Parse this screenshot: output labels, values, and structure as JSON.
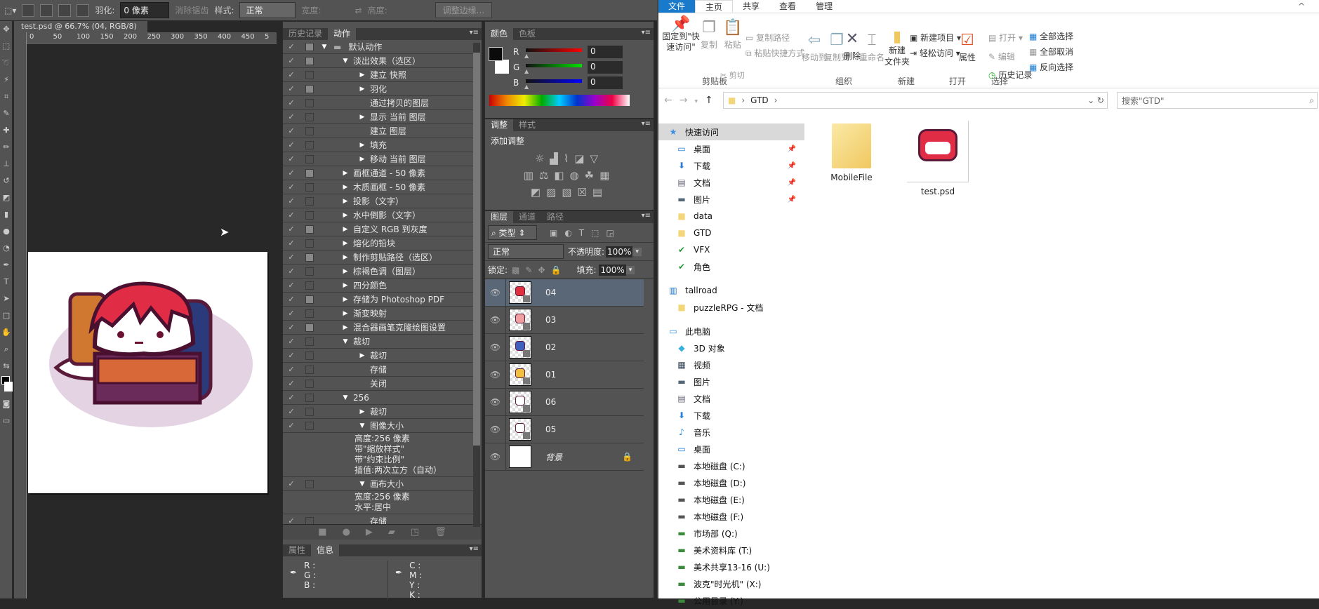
{
  "options_bar": {
    "feather_label": "羽化:",
    "feather_value": "0 像素",
    "antialias": "消除锯齿",
    "style_label": "样式:",
    "style_value": "正常",
    "width_label": "宽度:",
    "height_label": "高度:",
    "refine_edge": "调整边缘..."
  },
  "document": {
    "tab": "test.psd @ 66.7% (04, RGB/8)",
    "close": "×",
    "ruler_h": [
      "0",
      "50",
      "100",
      "150",
      "200",
      "250",
      "300",
      "350",
      "400",
      "450",
      "5"
    ]
  },
  "actions_panel": {
    "tabs": [
      "历史记录",
      "动作"
    ],
    "rows": [
      {
        "label": "默认动作",
        "level": 0,
        "tri": "▼",
        "dialog": true,
        "folder": true
      },
      {
        "label": "淡出效果（选区）",
        "level": 1,
        "tri": "▼",
        "dialog": true
      },
      {
        "label": "建立 快照",
        "level": 2,
        "tri": "▶",
        "dialog": false
      },
      {
        "label": "羽化",
        "level": 2,
        "tri": "▶",
        "dialog": true
      },
      {
        "label": "通过拷贝的图层",
        "level": 2,
        "tri": "",
        "dialog": false
      },
      {
        "label": "显示 当前 图层",
        "level": 2,
        "tri": "▶",
        "dialog": false
      },
      {
        "label": "建立 图层",
        "level": 2,
        "tri": "",
        "dialog": false
      },
      {
        "label": "填充",
        "level": 2,
        "tri": "▶",
        "dialog": false
      },
      {
        "label": "移动 当前 图层",
        "level": 2,
        "tri": "▶",
        "dialog": false
      },
      {
        "label": "画框通道 - 50 像素",
        "level": 1,
        "tri": "▶",
        "dialog": true
      },
      {
        "label": "木质画框 - 50 像素",
        "level": 1,
        "tri": "▶",
        "dialog": false
      },
      {
        "label": "投影（文字）",
        "level": 1,
        "tri": "▶",
        "dialog": false
      },
      {
        "label": "水中倒影（文字）",
        "level": 1,
        "tri": "▶",
        "dialog": false
      },
      {
        "label": "自定义 RGB 到灰度",
        "level": 1,
        "tri": "▶",
        "dialog": true
      },
      {
        "label": "熔化的铅块",
        "level": 1,
        "tri": "▶",
        "dialog": false
      },
      {
        "label": "制作剪贴路径（选区）",
        "level": 1,
        "tri": "▶",
        "dialog": true
      },
      {
        "label": "棕褐色调（图层）",
        "level": 1,
        "tri": "▶",
        "dialog": false
      },
      {
        "label": "四分颜色",
        "level": 1,
        "tri": "▶",
        "dialog": false
      },
      {
        "label": "存储为 Photoshop PDF",
        "level": 1,
        "tri": "▶",
        "dialog": true
      },
      {
        "label": "渐变映射",
        "level": 1,
        "tri": "▶",
        "dialog": false
      },
      {
        "label": "混合器画笔克隆绘图设置",
        "level": 1,
        "tri": "▶",
        "dialog": true
      },
      {
        "label": "裁切",
        "level": 1,
        "tri": "▼",
        "dialog": false
      },
      {
        "label": "裁切",
        "level": 2,
        "tri": "▶",
        "dialog": false
      },
      {
        "label": "存储",
        "level": 2,
        "tri": "",
        "dialog": false
      },
      {
        "label": "关闭",
        "level": 2,
        "tri": "",
        "dialog": false
      },
      {
        "label": "256",
        "level": 1,
        "tri": "▼",
        "dialog": false
      },
      {
        "label": "裁切",
        "level": 2,
        "tri": "▶",
        "dialog": false
      },
      {
        "label": "图像大小",
        "level": 2,
        "tri": "▼",
        "dialog": false,
        "params": [
          "高度:256 像素",
          "带\"缩放样式\"",
          "带\"约束比例\"",
          "插值:两次立方（自动）"
        ]
      },
      {
        "label": "画布大小",
        "level": 2,
        "tri": "▼",
        "dialog": false,
        "params": [
          "宽度:256 像素",
          "水平:居中"
        ]
      },
      {
        "label": "存储",
        "level": 2,
        "tri": "",
        "dialog": false
      }
    ]
  },
  "info_panel": {
    "tabs": [
      "属性",
      "信息"
    ],
    "left": [
      "R :",
      "G :",
      "B :"
    ],
    "right": [
      "C :",
      "M :",
      "Y :",
      "K :"
    ]
  },
  "color_panel": {
    "tabs": [
      "颜色",
      "色板"
    ],
    "channels": [
      {
        "label": "R",
        "value": "0",
        "color": "#ff0000"
      },
      {
        "label": "G",
        "value": "0",
        "color": "#00e000"
      },
      {
        "label": "B",
        "value": "0",
        "color": "#0000ff"
      }
    ]
  },
  "adjust_panel": {
    "tabs": [
      "调整",
      "样式"
    ],
    "title": "添加调整"
  },
  "layers_panel": {
    "tabs": [
      "图层",
      "通道",
      "路径"
    ],
    "filter": "类型",
    "blend": "正常",
    "opacity_label": "不透明度:",
    "opacity": "100%",
    "lock_label": "锁定:",
    "fill_label": "填充:",
    "fill": "100%",
    "layers": [
      {
        "name": "04",
        "selected": true,
        "hair": "#e03040"
      },
      {
        "name": "03",
        "hair": "#f0a0a0"
      },
      {
        "name": "02",
        "hair": "#4060c0"
      },
      {
        "name": "01",
        "hair": "#f0c040"
      },
      {
        "name": "06",
        "hair": "#ffffff"
      },
      {
        "name": "05",
        "hair": "#ffffff"
      },
      {
        "name": "背景",
        "locked": true,
        "background": true
      }
    ]
  },
  "explorer": {
    "tabs": [
      "文件",
      "主页",
      "共享",
      "查看",
      "管理"
    ],
    "ribbon": {
      "pin": "固定到\"快\n速访问\"",
      "copy": "复制",
      "paste": "粘贴",
      "copy_path": "复制路径",
      "paste_shortcut": "粘贴快捷方式",
      "cut": "剪切",
      "move_to": "移动到",
      "copy_to": "复制到",
      "delete": "删除",
      "rename": "重命名",
      "new_folder": "新建\n文件夹",
      "new_item": "新建项目",
      "easy_access": "轻松访问",
      "properties": "属性",
      "open": "打开",
      "edit": "编辑",
      "history": "历史记录",
      "select_all": "全部选择",
      "select_none": "全部取消",
      "invert": "反向选择",
      "groups": [
        "剪贴板",
        "组织",
        "新建",
        "打开",
        "选择"
      ]
    },
    "address": "GTD",
    "search_placeholder": "搜索\"GTD\"",
    "nav": [
      {
        "label": "快速访问",
        "icon": "★",
        "color": "#3a8ee6",
        "level": 0,
        "selected": true
      },
      {
        "label": "桌面",
        "icon": "▭",
        "color": "#1e7fd8",
        "level": 1,
        "pinned": true
      },
      {
        "label": "下载",
        "icon": "⬇",
        "color": "#2a7fd8",
        "level": 1,
        "pinned": true
      },
      {
        "label": "文档",
        "icon": "▤",
        "color": "#667",
        "level": 1,
        "pinned": true
      },
      {
        "label": "图片",
        "icon": "▬",
        "color": "#567",
        "level": 1,
        "pinned": true
      },
      {
        "label": "data",
        "icon": "■",
        "color": "#f3d57a",
        "level": 1
      },
      {
        "label": "GTD",
        "icon": "■",
        "color": "#f3d57a",
        "level": 1
      },
      {
        "label": "VFX",
        "icon": "✔",
        "color": "#2a9a3a",
        "level": 1
      },
      {
        "label": "角色",
        "icon": "✔",
        "color": "#2a9a3a",
        "level": 1
      },
      {
        "label": "tallroad",
        "icon": "▥",
        "color": "#1e6fc8",
        "level": 0,
        "gap": true
      },
      {
        "label": "puzzleRPG - 文档",
        "icon": "■",
        "color": "#f3d57a",
        "level": 1
      },
      {
        "label": "此电脑",
        "icon": "▭",
        "color": "#3a8ed8",
        "level": 0,
        "gap": true
      },
      {
        "label": "3D 对象",
        "icon": "◆",
        "color": "#3ab0e0",
        "level": 1
      },
      {
        "label": "视频",
        "icon": "▦",
        "color": "#345",
        "level": 1
      },
      {
        "label": "图片",
        "icon": "▬",
        "color": "#567",
        "level": 1
      },
      {
        "label": "文档",
        "icon": "▤",
        "color": "#667",
        "level": 1
      },
      {
        "label": "下载",
        "icon": "⬇",
        "color": "#2a7fd8",
        "level": 1
      },
      {
        "label": "音乐",
        "icon": "♪",
        "color": "#2a8fe0",
        "level": 1
      },
      {
        "label": "桌面",
        "icon": "▭",
        "color": "#1e7fd8",
        "level": 1
      },
      {
        "label": "本地磁盘 (C:)",
        "icon": "▬",
        "color": "#555",
        "level": 1
      },
      {
        "label": "本地磁盘 (D:)",
        "icon": "▬",
        "color": "#555",
        "level": 1
      },
      {
        "label": "本地磁盘 (E:)",
        "icon": "▬",
        "color": "#555",
        "level": 1
      },
      {
        "label": "本地磁盘 (F:)",
        "icon": "▬",
        "color": "#555",
        "level": 1
      },
      {
        "label": "市场部 (Q:)",
        "icon": "▬",
        "color": "#3a8a3a",
        "level": 1
      },
      {
        "label": "美术资料库 (T:)",
        "icon": "▬",
        "color": "#3a8a3a",
        "level": 1
      },
      {
        "label": "美术共享13-16 (U:)",
        "icon": "▬",
        "color": "#3a8a3a",
        "level": 1
      },
      {
        "label": "波克\"时光机\" (X:)",
        "icon": "▬",
        "color": "#3a8a3a",
        "level": 1
      },
      {
        "label": "公用目录 (Y:)",
        "icon": "▬",
        "color": "#3a8a3a",
        "level": 1
      }
    ],
    "files": [
      {
        "name": "MobileFile",
        "type": "folder"
      },
      {
        "name": "test.psd",
        "type": "psd"
      }
    ]
  }
}
